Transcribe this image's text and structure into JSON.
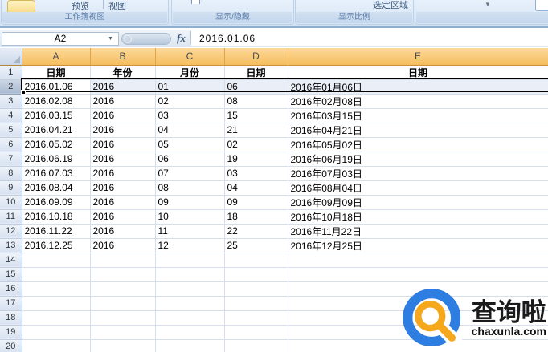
{
  "ribbon": {
    "preview_label": "预览",
    "view_label": "视图",
    "group_workbook_views": "工作簿视图",
    "group_show_hide": "显示/隐藏",
    "group_zoom": "显示比例",
    "zoom_to_selection_label": "选定区域",
    "gallery_arrow": "▼"
  },
  "formula_bar": {
    "name_box_value": "A2",
    "name_box_arrow": "▼",
    "fx_label": "fx",
    "formula_value": "2016.01.06"
  },
  "spreadsheet": {
    "columns": [
      "A",
      "B",
      "C",
      "D",
      "E"
    ],
    "header_row": [
      "日期",
      "年份",
      "月份",
      "日期",
      "日期"
    ],
    "rows": [
      [
        "2016.01.06",
        "2016",
        "01",
        "06",
        "2016年01月06日"
      ],
      [
        "2016.02.08",
        "2016",
        "02",
        "08",
        "2016年02月08日"
      ],
      [
        "2016.03.15",
        "2016",
        "03",
        "15",
        "2016年03月15日"
      ],
      [
        "2016.04.21",
        "2016",
        "04",
        "21",
        "2016年04月21日"
      ],
      [
        "2016.05.02",
        "2016",
        "05",
        "02",
        "2016年05月02日"
      ],
      [
        "2016.06.19",
        "2016",
        "06",
        "19",
        "2016年06月19日"
      ],
      [
        "2016.07.03",
        "2016",
        "07",
        "03",
        "2016年07月03日"
      ],
      [
        "2016.08.04",
        "2016",
        "08",
        "04",
        "2016年08月04日"
      ],
      [
        "2016.09.09",
        "2016",
        "09",
        "09",
        "2016年09月09日"
      ],
      [
        "2016.10.18",
        "2016",
        "10",
        "18",
        "2016年10月18日"
      ],
      [
        "2016.11.22",
        "2016",
        "11",
        "22",
        "2016年11月22日"
      ],
      [
        "2016.12.25",
        "2016",
        "12",
        "25",
        "2016年12月25日"
      ]
    ],
    "first_data_row_number": 2,
    "total_visible_rows": 20,
    "selected_row_number": 2,
    "active_cell": "A2"
  },
  "watermark": {
    "brand": "查询啦",
    "domain": "chaxunla.com",
    "colors": {
      "blue": "#2e7de0",
      "orange": "#f6a81c"
    }
  }
}
